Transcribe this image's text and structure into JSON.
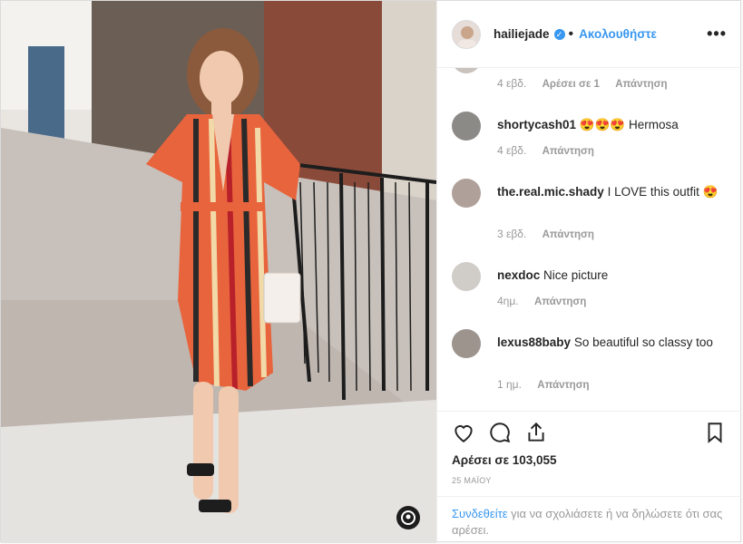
{
  "post": {
    "username": "hailiejade",
    "verified_mark": "✓",
    "follow_label": "Ακολουθήστε",
    "more_label": "•••"
  },
  "comments": [
    {
      "username": "",
      "text": "",
      "time": "4 εβδ.",
      "likes": "Αρέσει σε 1",
      "reply": "Απάντηση"
    },
    {
      "username": "shortycash01",
      "text": "😍😍😍 Hermosa",
      "time": "4 εβδ.",
      "reply": "Απάντηση"
    },
    {
      "username": "the.real.mic.shady",
      "text": "I LOVE this outfit 😍",
      "time": "3 εβδ.",
      "reply": "Απάντηση"
    },
    {
      "username": "nexdoc",
      "text": "Nice picture",
      "time": "4ημ.",
      "reply": "Απάντηση"
    },
    {
      "username": "lexus88baby",
      "text": "So beautiful so classy too",
      "time": "1 ημ.",
      "reply": "Απάντηση"
    }
  ],
  "stats": {
    "likes_text": "Αρέσει σε 103,055",
    "date_text": "25 ΜΑΪΟΥ"
  },
  "login_prompt": {
    "link": "Συνδεθείτε",
    "rest": " για να σχολιάσετε ή να δηλώσετε ότι σας αρέσει."
  },
  "colors": {
    "accent": "#3897f0",
    "muted": "#999999"
  },
  "icons": [
    "heart-icon",
    "comment-icon",
    "share-icon",
    "bookmark-icon",
    "more-icon",
    "verified-icon",
    "tag-icon"
  ]
}
